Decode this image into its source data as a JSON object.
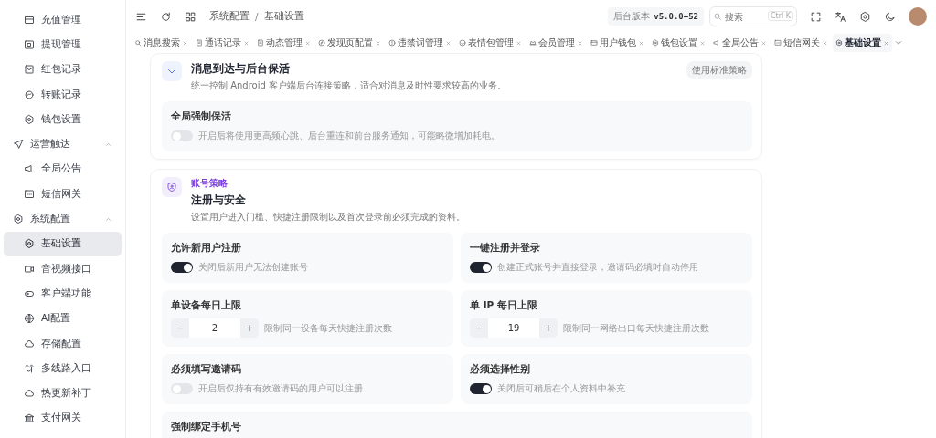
{
  "sidebar": {
    "items": [
      {
        "kind": "item",
        "label": "充值管理",
        "selected": false
      },
      {
        "kind": "item",
        "label": "提现管理",
        "selected": false
      },
      {
        "kind": "item",
        "label": "红包记录",
        "selected": false
      },
      {
        "kind": "item",
        "label": "转账记录",
        "selected": false
      },
      {
        "kind": "item",
        "label": "钱包设置",
        "selected": false
      },
      {
        "kind": "group",
        "label": "运营触达",
        "expanded": true
      },
      {
        "kind": "item",
        "label": "全局公告",
        "selected": false
      },
      {
        "kind": "item",
        "label": "短信网关",
        "selected": false
      },
      {
        "kind": "group",
        "label": "系统配置",
        "expanded": true
      },
      {
        "kind": "item",
        "label": "基础设置",
        "selected": true
      },
      {
        "kind": "item",
        "label": "音视频接口",
        "selected": false
      },
      {
        "kind": "item",
        "label": "客户端功能",
        "selected": false
      },
      {
        "kind": "item",
        "label": "AI配置",
        "selected": false
      },
      {
        "kind": "item",
        "label": "存储配置",
        "selected": false
      },
      {
        "kind": "item",
        "label": "多线路入口",
        "selected": false
      },
      {
        "kind": "item",
        "label": "热更新补丁",
        "selected": false
      },
      {
        "kind": "item",
        "label": "支付网关",
        "selected": false
      }
    ]
  },
  "header": {
    "breadcrumb": [
      "系统配置",
      "基础设置"
    ],
    "separator": "/",
    "version_label": "后台版本",
    "version": "v5.0.0+52",
    "search": {
      "placeholder": "搜索",
      "shortcut": "Ctrl K"
    }
  },
  "tabs": [
    {
      "label": "消息搜索",
      "selected": false
    },
    {
      "label": "通话记录",
      "selected": false
    },
    {
      "label": "动态管理",
      "selected": false
    },
    {
      "label": "发现页配置",
      "selected": false
    },
    {
      "label": "违禁词管理",
      "selected": false
    },
    {
      "label": "表情包管理",
      "selected": false
    },
    {
      "label": "会员管理",
      "selected": false
    },
    {
      "label": "用户钱包",
      "selected": false
    },
    {
      "label": "钱包设置",
      "selected": false
    },
    {
      "label": "全局公告",
      "selected": false
    },
    {
      "label": "短信网关",
      "selected": false
    },
    {
      "label": "基础设置",
      "selected": true
    }
  ],
  "sections": [
    {
      "title": "消息到达与后台保活",
      "description": "统一控制 Android 客户端后台连接策略，适合对消息及时性要求较高的业务。",
      "action": "使用标准策略",
      "rows": [
        {
          "kind": "toggle",
          "label": "全局强制保活",
          "on": false,
          "hint": "开启后将使用更高频心跳、后台重连和前台服务通知，可能略微增加耗电。"
        }
      ]
    },
    {
      "tag": "账号策略",
      "title": "注册与安全",
      "description": "设置用户进入门槛、快捷注册限制以及首次登录前必须完成的资料。",
      "rows": [
        {
          "kind": "toggle",
          "label": "允许新用户注册",
          "on": true,
          "hint": "关闭后新用户无法创建账号"
        },
        {
          "kind": "toggle",
          "label": "一键注册并登录",
          "on": true,
          "hint": "创建正式账号并直接登录，邀请码必填时自动停用"
        },
        {
          "kind": "stepper",
          "label": "单设备每日上限",
          "value": "2",
          "minus": "−",
          "plus": "+",
          "hint": "限制同一设备每天快捷注册次数"
        },
        {
          "kind": "stepper",
          "label": "单 IP 每日上限",
          "value": "19",
          "minus": "−",
          "plus": "+",
          "hint": "限制同一网络出口每天快捷注册次数"
        },
        {
          "kind": "toggle",
          "label": "必须填写邀请码",
          "on": false,
          "hint": "开启后仅持有有效邀请码的用户可以注册"
        },
        {
          "kind": "toggle",
          "label": "必须选择性别",
          "on": true,
          "hint": "关闭后可稍后在个人资料中补充"
        },
        {
          "kind": "title",
          "label": "强制绑定手机号"
        }
      ]
    }
  ]
}
